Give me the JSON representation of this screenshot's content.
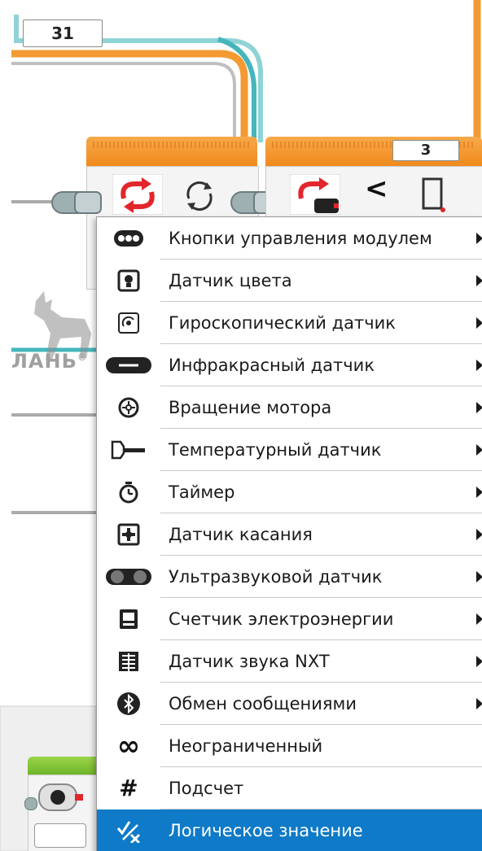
{
  "blocks": {
    "top_number": "31",
    "compare_value": "3",
    "compare_operator": "<"
  },
  "watermark": {
    "text": "ЛАНЬ",
    "registered": "®"
  },
  "menu": {
    "items": [
      {
        "label": "Кнопки управления модулем",
        "icon": "brick-buttons-icon",
        "submenu": true
      },
      {
        "label": "Датчик цвета",
        "icon": "color-sensor-icon",
        "submenu": true
      },
      {
        "label": "Гироскопический датчик",
        "icon": "gyro-sensor-icon",
        "submenu": true
      },
      {
        "label": "Инфракрасный датчик",
        "icon": "infrared-sensor-icon",
        "submenu": true
      },
      {
        "label": "Вращение мотора",
        "icon": "motor-rotation-icon",
        "submenu": true
      },
      {
        "label": "Температурный датчик",
        "icon": "temperature-sensor-icon",
        "submenu": true
      },
      {
        "label": "Таймер",
        "icon": "timer-icon",
        "submenu": true
      },
      {
        "label": "Датчик касания",
        "icon": "touch-sensor-icon",
        "submenu": true
      },
      {
        "label": "Ультразвуковой датчик",
        "icon": "ultrasonic-sensor-icon",
        "submenu": true
      },
      {
        "label": "Счетчик электроэнергии",
        "icon": "energy-meter-icon",
        "submenu": true
      },
      {
        "label": "Датчик звука NXT",
        "icon": "nxt-sound-sensor-icon",
        "submenu": true
      },
      {
        "label": "Обмен сообщениями",
        "icon": "bluetooth-messaging-icon",
        "submenu": true
      },
      {
        "label": "Неограниченный",
        "icon": "infinity-icon",
        "submenu": false
      },
      {
        "label": "Подсчет",
        "icon": "count-hash-icon",
        "submenu": false
      },
      {
        "label": "Логическое значение",
        "icon": "logic-value-icon",
        "submenu": false,
        "selected": true
      }
    ]
  },
  "colors": {
    "accent_orange": "#f08a1c",
    "wire_teal": "#3fb3b8",
    "selected_blue": "#0e7ac8",
    "loop_red": "#e3262b"
  }
}
